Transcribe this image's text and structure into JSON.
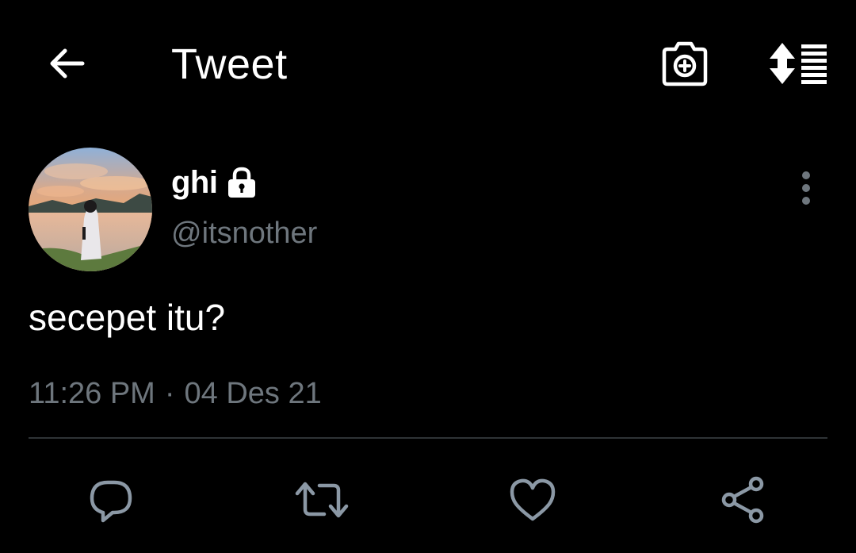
{
  "header": {
    "title": "Tweet"
  },
  "author": {
    "display_name": "ghi",
    "handle": "@itsnother",
    "protected": true
  },
  "tweet": {
    "text": "secepet itu?",
    "time": "11:26 PM",
    "separator": "·",
    "date": "04 Des 21"
  },
  "icons": {
    "back": "arrow-left-icon",
    "camera": "camera-plus-icon",
    "sort": "sort-icon",
    "lock": "lock-icon",
    "more": "more-vertical-icon",
    "reply": "reply-icon",
    "retweet": "retweet-icon",
    "like": "heart-icon",
    "share": "share-icon"
  },
  "colors": {
    "background": "#000000",
    "primary_text": "#ffffff",
    "secondary_text": "#6e767d",
    "divider": "#2f3336",
    "icon_muted": "#8b98a5"
  }
}
